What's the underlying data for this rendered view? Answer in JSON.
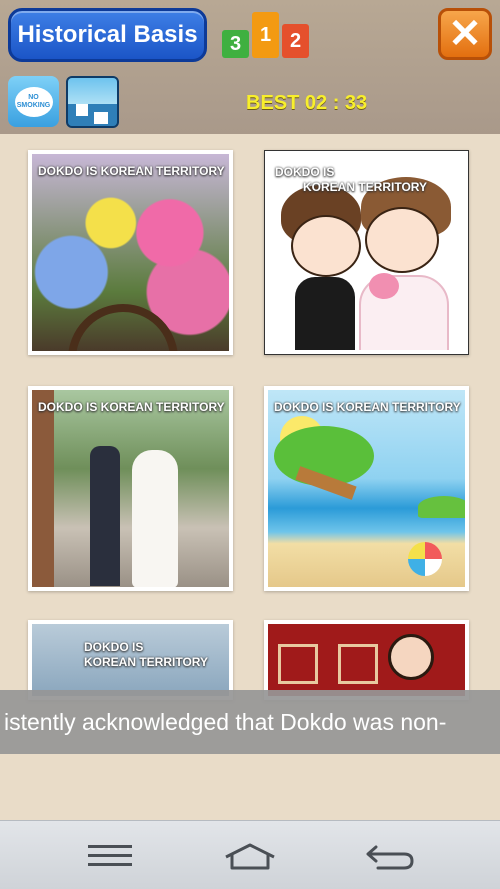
{
  "header": {
    "title": "Historical Basis",
    "ranks": [
      "3",
      "1",
      "2"
    ],
    "close_icon": "close-icon",
    "no_smoking_text": "NO SMOKING",
    "best_label": "BEST 02 : 33"
  },
  "gallery": {
    "items": [
      {
        "caption": "DOKDO IS KOREAN TERRITORY"
      },
      {
        "caption_line1": "DOKDO IS",
        "caption_line2": "KOREAN TERRITORY"
      },
      {
        "caption": "DOKDO IS KOREAN TERRITORY"
      },
      {
        "caption": "DOKDO IS KOREAN TERRITORY"
      },
      {
        "caption_line1": "DOKDO IS",
        "caption_line2": "KOREAN TERRITORY"
      },
      {
        "caption": ""
      }
    ]
  },
  "marquee": {
    "text": "istently acknowledged that Dokdo was non-"
  },
  "navbar": {
    "menu_icon": "menu-icon",
    "home_icon": "home-icon",
    "back_icon": "back-icon"
  }
}
